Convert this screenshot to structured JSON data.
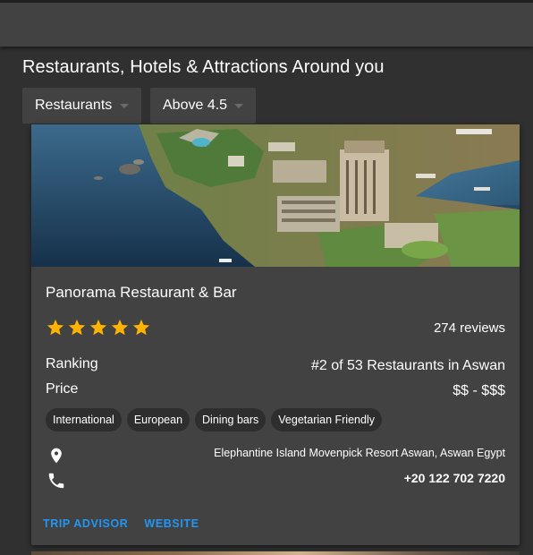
{
  "page": {
    "title": "Restaurants, Hotels & Attractions Around you"
  },
  "filters": {
    "category": {
      "selected": "Restaurants"
    },
    "rating": {
      "selected": "Above 4.5"
    }
  },
  "listing": {
    "name": "Panorama Restaurant & Bar",
    "rating": 5,
    "reviews": "274 reviews",
    "ranking_label": "Ranking",
    "ranking_value": "#2 of 53 Restaurants in Aswan",
    "price_label": "Price",
    "price_value": "$$ - $$$",
    "cuisines": [
      "International",
      "European",
      "Dining bars",
      "Vegetarian Friendly"
    ],
    "address": "Elephantine Island Movenpick Resort Aswan, Aswan Egypt",
    "phone": "+20 122 702 7220",
    "actions": {
      "tripadvisor": "TRIP ADVISOR",
      "website": "WEBSITE"
    },
    "icons": {
      "address": "location-pin-icon",
      "phone": "phone-icon",
      "rating": "star-icon"
    }
  },
  "colors": {
    "background": "#303030",
    "surface": "#424242",
    "app_bar": "#424242",
    "chip": "#2e2e2e",
    "star": "#ffb300",
    "link": "#2196f3",
    "text": "#ffffff"
  }
}
